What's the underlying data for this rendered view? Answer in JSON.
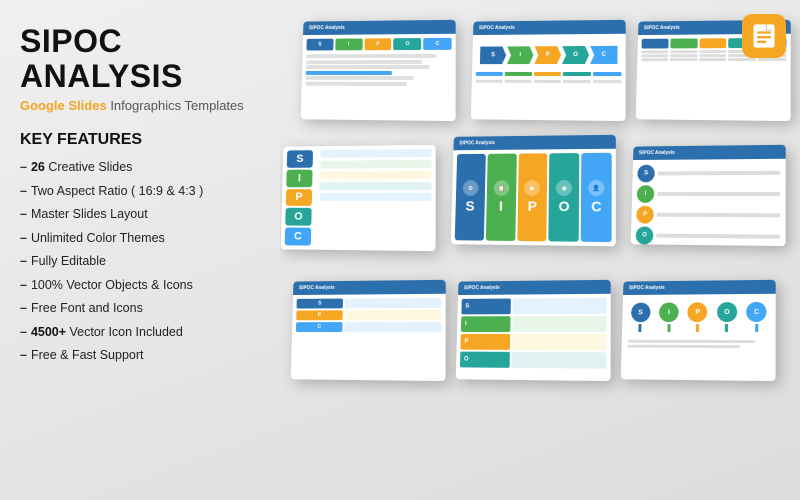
{
  "title": "SIPOC ANALYSIS",
  "subtitle": {
    "google": "Google Slides",
    "rest": " Infographics Templates"
  },
  "features_heading": "KEY FEATURES",
  "features": [
    {
      "id": "f1",
      "prefix": "– ",
      "bold": "26",
      "text": " Creative Slides"
    },
    {
      "id": "f2",
      "prefix": "– ",
      "bold": "",
      "text": "Two Aspect Ratio ( 16:9 & 4:3 )"
    },
    {
      "id": "f3",
      "prefix": "– ",
      "bold": "",
      "text": "Master Slides Layout"
    },
    {
      "id": "f4",
      "prefix": "– ",
      "bold": "",
      "text": "Unlimited Color Themes"
    },
    {
      "id": "f5",
      "prefix": "– ",
      "bold": "",
      "text": "Fully Editable"
    },
    {
      "id": "f6",
      "prefix": "– ",
      "bold": "",
      "text": "100% Vector Objects & Icons"
    },
    {
      "id": "f7",
      "prefix": "– ",
      "bold": "",
      "text": "Free Font and Icons"
    },
    {
      "id": "f8",
      "prefix": "– ",
      "bold": "4500+",
      "text": " Vector Icon Included"
    },
    {
      "id": "f9",
      "prefix": "– ",
      "bold": "",
      "text": "Free & Fast Support"
    }
  ],
  "logo_alt": "Google Slides logo",
  "slides_label": "Slide previews"
}
